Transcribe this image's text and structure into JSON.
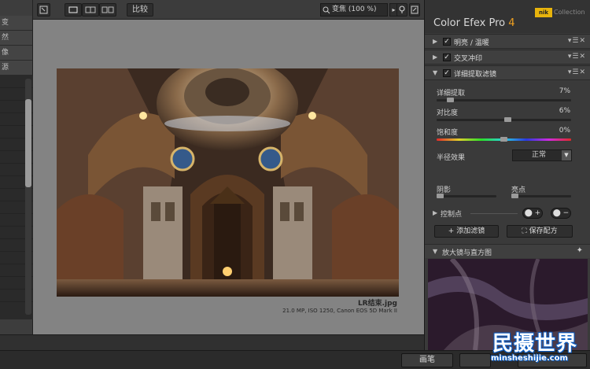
{
  "left_panel": {
    "items": [
      "变",
      "然",
      "像",
      "源"
    ]
  },
  "toolbar": {
    "compare_label": "比较",
    "zoom_value": "变焦 (100 %)"
  },
  "photo": {
    "filename": "LR结束.jpg",
    "meta": "21.0 MP, ISO 1250, Canon EOS 5D Mark II"
  },
  "brand": {
    "title": "Color Efex Pro",
    "version": "4",
    "logo_text": "nik",
    "collection": "Collection"
  },
  "filters": [
    {
      "name": "明亮 / 温暖",
      "expanded": false,
      "checked": true
    },
    {
      "name": "交叉冲印",
      "expanded": false,
      "checked": true
    },
    {
      "name": "详细提取滤镜",
      "expanded": true,
      "checked": true
    }
  ],
  "sliders": {
    "detail": {
      "label": "详细提取",
      "value": "7%"
    },
    "contrast": {
      "label": "对比度",
      "value": "6%"
    },
    "saturation": {
      "label": "饱和度",
      "value": "0%"
    }
  },
  "radius": {
    "label": "半径效果",
    "value": "正常"
  },
  "shadows_label": "阴影",
  "highlights_label": "亮点",
  "control_points_label": "控制点",
  "add_filter_label": "添加滤镜",
  "save_recipe_label": "保存配方",
  "loupe_label": "放大镜与直方图",
  "footer": {
    "brush_label": "画笔"
  },
  "watermark": {
    "main": "民摄世界",
    "url": "minsheshijie.com"
  }
}
